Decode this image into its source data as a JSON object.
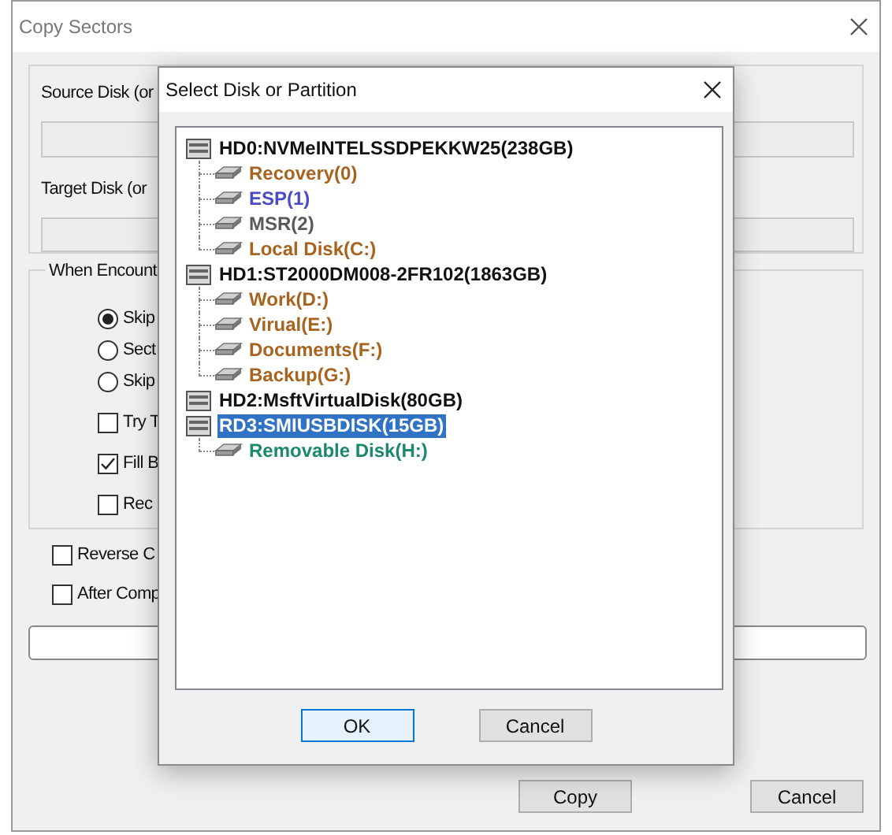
{
  "window": {
    "title": "Copy Sectors"
  },
  "source": {
    "label": "Source Disk (or"
  },
  "target": {
    "label": "Target Disk (or"
  },
  "error_group": {
    "title": "When Encount",
    "options": [
      {
        "kind": "radio",
        "label": "Skip",
        "checked": true
      },
      {
        "kind": "radio",
        "label": "Sect",
        "checked": false
      },
      {
        "kind": "radio",
        "label": "Skip",
        "checked": false
      },
      {
        "kind": "checkbox",
        "label": "Try T",
        "checked": false
      },
      {
        "kind": "checkbox",
        "label": "Fill B",
        "checked": true
      },
      {
        "kind": "checkbox",
        "label": "Rec",
        "checked": false
      }
    ]
  },
  "options": [
    {
      "label": "Reverse C",
      "checked": false
    },
    {
      "label": "After Comp",
      "checked": false
    }
  ],
  "progress": {
    "level": 0
  },
  "buttons": [
    "Copy",
    "Cancel"
  ],
  "dialog": {
    "title": "Select Disk or Partition",
    "tree": [
      {
        "label": "HD0:NVMeINTELSSDPEKKW25(238GB)",
        "selected": false,
        "children": [
          {
            "label": "Recovery(0)",
            "color": "#a8641e",
            "selected": false
          },
          {
            "label": "ESP(1)",
            "color": "#4b4bc8",
            "selected": false
          },
          {
            "label": "MSR(2)",
            "color": "#5a5a5a",
            "selected": false
          },
          {
            "label": "Local Disk(C:)",
            "color": "#a8641e",
            "selected": false
          }
        ]
      },
      {
        "label": "HD1:ST2000DM008-2FR102(1863GB)",
        "selected": false,
        "children": [
          {
            "label": "Work(D:)",
            "color": "#a8641e",
            "selected": false
          },
          {
            "label": "Virual(E:)",
            "color": "#a8641e",
            "selected": false
          },
          {
            "label": "Documents(F:)",
            "color": "#a8641e",
            "selected": false
          },
          {
            "label": "Backup(G:)",
            "color": "#a8641e",
            "selected": false
          }
        ]
      },
      {
        "label": "HD2:MsftVirtualDisk(80GB)",
        "selected": false
      },
      {
        "label": "RD3:SMIUSBDISK(15GB)",
        "selected": true,
        "children": [
          {
            "label": "Removable Disk(H:)",
            "color": "#1a8a6a",
            "selected": false
          }
        ]
      }
    ],
    "buttons": [
      "OK",
      "Cancel"
    ]
  }
}
